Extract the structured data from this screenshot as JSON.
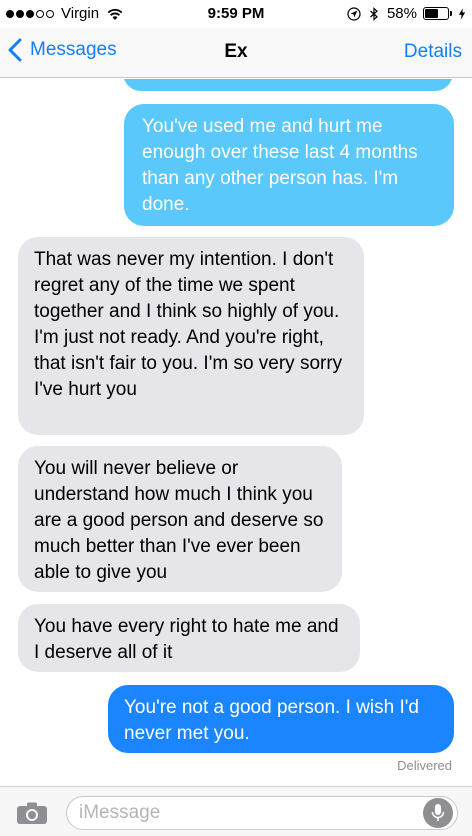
{
  "status_bar": {
    "carrier": "Virgin",
    "time": "9:59 PM",
    "battery": "58%",
    "battery_level": 0.58,
    "icons": [
      "wifi-icon",
      "location-icon",
      "bluetooth-icon",
      "battery-icon",
      "charging-icon"
    ]
  },
  "nav": {
    "back_label": "Messages",
    "title": "Ex",
    "details_label": "Details"
  },
  "messages": [
    {
      "type": "sent",
      "text": "You've used me and hurt me enough over these last 4 months than any other person has. I'm done."
    },
    {
      "type": "received",
      "text": "That was never my intention. I don't regret any of the time we spent together and I think so highly of you. I'm just not ready. And you're right, that isn't fair to you. I'm so very sorry I've hurt you"
    },
    {
      "type": "received",
      "text": "You will never believe or understand how much I think you are a good person and deserve so much better than I've ever been able to give you"
    },
    {
      "type": "received",
      "text": "You have every right to hate me and I deserve all of it"
    },
    {
      "type": "sent",
      "text": "You're not a good person. I wish I'd never met you."
    }
  ],
  "delivered_label": "Delivered",
  "input": {
    "placeholder": "iMessage",
    "value": ""
  },
  "colors": {
    "accent": "#137efb",
    "sent_bubble": "#5ac8fa",
    "sent_bubble_last": "#1a85ff",
    "received_bubble": "#e5e5ea"
  }
}
